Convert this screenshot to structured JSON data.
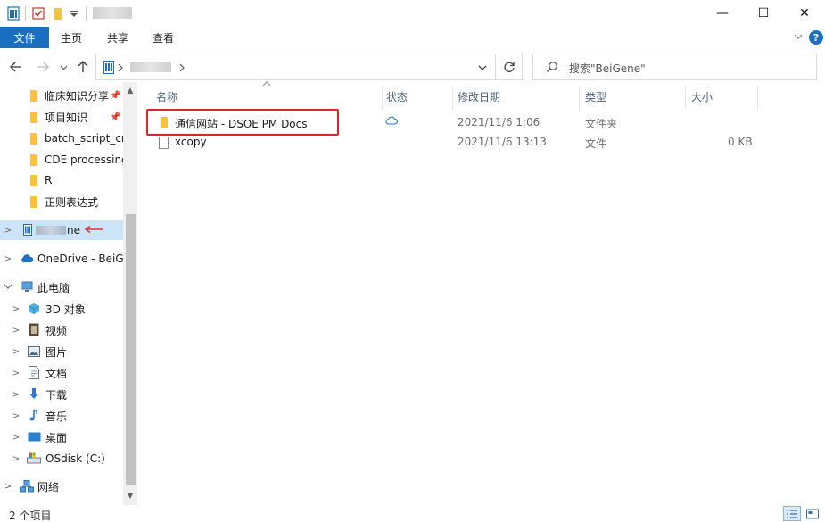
{
  "window": {
    "minimize_glyph": "—",
    "maximize_glyph": "☐",
    "close_glyph": "✕"
  },
  "ribbon": {
    "tabs": [
      {
        "label": "文件",
        "active": true
      },
      {
        "label": "主页"
      },
      {
        "label": "共享"
      },
      {
        "label": "查看"
      }
    ],
    "help_label": "?"
  },
  "address": {
    "search_placeholder": "搜索\"BeiGene\""
  },
  "nav": {
    "quick_access": [
      {
        "label": "临床知识分享",
        "pinned": true
      },
      {
        "label": "项目知识",
        "pinned": true
      },
      {
        "label": "batch_script_cr"
      },
      {
        "label": "CDE processing"
      },
      {
        "label": "R"
      },
      {
        "label": "正则表达式"
      }
    ],
    "selected_suffix": "ne",
    "onedrive_label": "OneDrive - BeiGe",
    "thispc_label": "此电脑",
    "thispc_children": [
      {
        "label": "3D 对象",
        "icon": "3d-objects-icon"
      },
      {
        "label": "视频",
        "icon": "video-icon"
      },
      {
        "label": "图片",
        "icon": "pictures-icon"
      },
      {
        "label": "文档",
        "icon": "documents-icon"
      },
      {
        "label": "下载",
        "icon": "download-icon"
      },
      {
        "label": "音乐",
        "icon": "music-icon"
      },
      {
        "label": "桌面",
        "icon": "desktop-icon"
      },
      {
        "label": "OSdisk (C:)",
        "icon": "drive-icon"
      }
    ],
    "network_label": "网络"
  },
  "columns": {
    "name": "名称",
    "status": "状态",
    "modified": "修改日期",
    "type": "类型",
    "size": "大小"
  },
  "files": [
    {
      "name": "通信网站 - DSOE PM Docs",
      "status": "cloud",
      "modified": "2021/11/6 1:06",
      "type": "文件夹",
      "size": ""
    },
    {
      "name": "xcopy",
      "status": "",
      "modified": "2021/11/6 13:13",
      "type": "文件",
      "size": "0 KB"
    }
  ],
  "statusbar": {
    "count": "2 个项目"
  },
  "colors": {
    "accent": "#1a6fc0",
    "selection": "#cce4f7",
    "highlight": "#e0242b",
    "arrow": "#d9343a"
  }
}
